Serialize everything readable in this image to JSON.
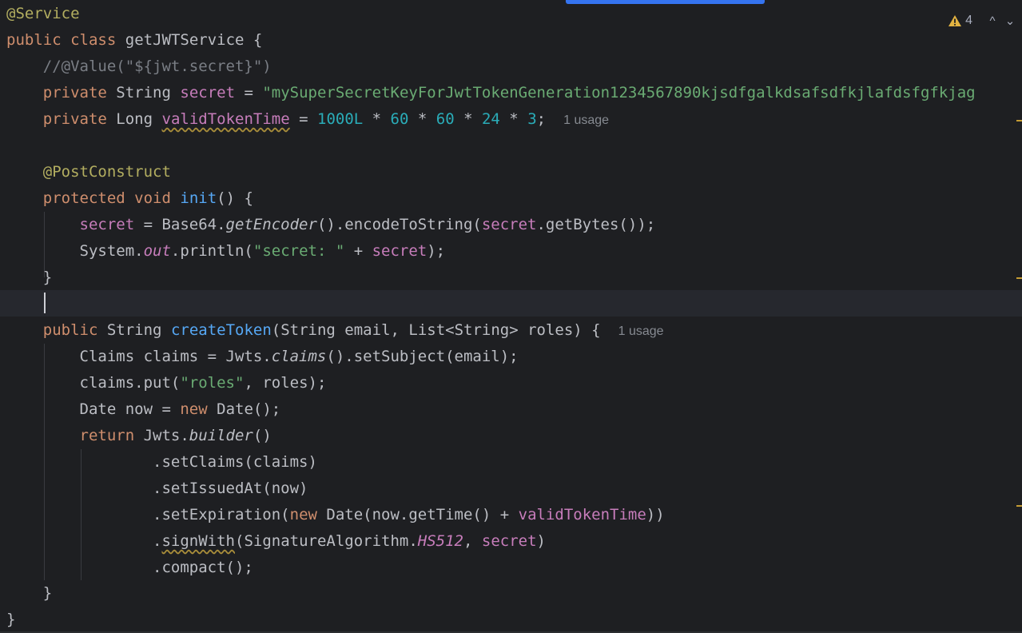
{
  "inspections": {
    "warning_count": "4",
    "prev_label": "^",
    "next_label": "⌄"
  },
  "code": {
    "l1": {
      "annotation": "@Service"
    },
    "l2": {
      "kw1": "public",
      "kw2": "class",
      "name": "getJWTService",
      "brace": "{"
    },
    "l3": {
      "comment": "//@Value(\"${jwt.secret}\")"
    },
    "l4": {
      "kw": "private",
      "type": "String",
      "field": "secret",
      "eq": " = ",
      "str": "\"mySuperSecretKeyForJwtTokenGeneration1234567890kjsdfgalkdsafsdfkjlafdsfgfkjag"
    },
    "l5": {
      "kw": "private",
      "type": "Long",
      "field": "validTokenTime",
      "eq": " = ",
      "n1": "1000L",
      "m1": " * ",
      "n2": "60",
      "m2": " * ",
      "n3": "60",
      "m3": " * ",
      "n4": "24",
      "m4": " * ",
      "n5": "3",
      "semi": ";",
      "hint": "1 usage"
    },
    "l7": {
      "annotation": "@PostConstruct"
    },
    "l8": {
      "kw1": "protected",
      "kw2": "void",
      "fn": "init",
      "rest": "() {"
    },
    "l9": {
      "field": "secret",
      "p1": " = Base64.",
      "call": "getEncoder",
      "p2": "().encodeToString(",
      "field2": "secret",
      "p3": ".getBytes());"
    },
    "l10": {
      "p1": "System.",
      "out": "out",
      "p2": ".println(",
      "str": "\"secret: \"",
      "p3": " + ",
      "field": "secret",
      "p4": ");"
    },
    "l11": {
      "brace": "}"
    },
    "l13": {
      "kw": "public",
      "type": "String",
      "fn": "createToken",
      "rest": "(String email, List<String> roles) {",
      "hint": "1 usage"
    },
    "l14": {
      "p1": "Claims claims = Jwts.",
      "call": "claims",
      "p2": "().setSubject(email);"
    },
    "l15": {
      "p1": "claims.put(",
      "str": "\"roles\"",
      "p2": ", roles);"
    },
    "l16": {
      "p1": "Date now = ",
      "kw": "new",
      "p2": " Date();"
    },
    "l17": {
      "kw": "return",
      "p1": " Jwts.",
      "call": "builder",
      "p2": "()"
    },
    "l18": {
      "text": ".setClaims(claims)"
    },
    "l19": {
      "text": ".setIssuedAt(now)"
    },
    "l20": {
      "p1": ".setExpiration(",
      "kw": "new",
      "p2": " Date(now.getTime() + ",
      "field": "validTokenTime",
      "p3": "))"
    },
    "l21": {
      "dot": ".",
      "method": "signWith",
      "p1": "(SignatureAlgorithm.",
      "const": "HS512",
      "p2": ", ",
      "field": "secret",
      "p3": ")"
    },
    "l22": {
      "text": ".compact();"
    },
    "l23": {
      "brace": "}"
    },
    "l24": {
      "brace": "}"
    }
  },
  "colors": {
    "background": "#1e1f22",
    "keyword": "#cf8e6d",
    "annotation": "#b3ae60",
    "string": "#6aab73",
    "number": "#2aacb8",
    "field": "#c77dbb",
    "function": "#56a8f5",
    "scrollbar_accent": "#3574f0",
    "warning": "#e3b341"
  }
}
